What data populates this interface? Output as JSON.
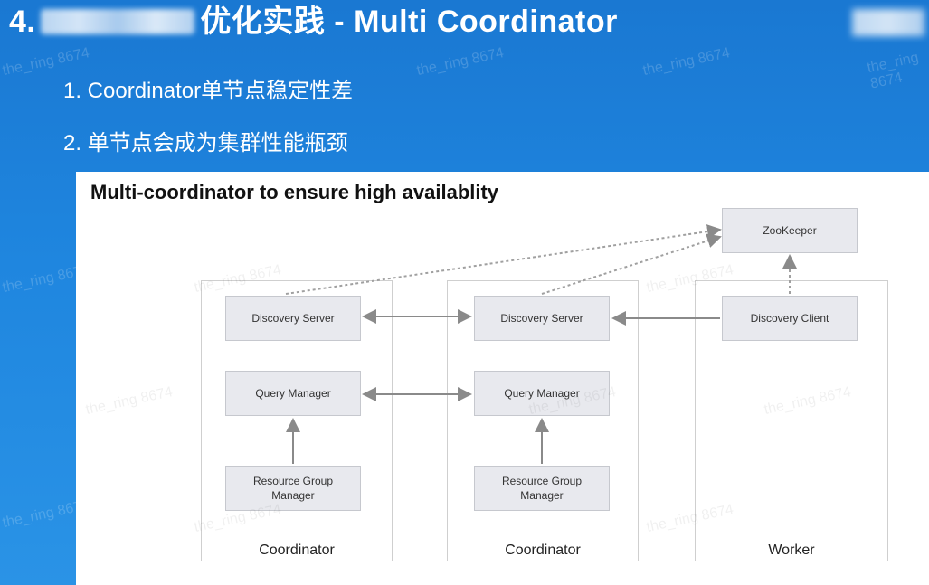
{
  "header": {
    "title_prefix": "4.",
    "title_suffix": "优化实践 - Multi Coordinator"
  },
  "bullets": [
    "1. Coordinator单节点稳定性差",
    "2. 单节点会成为集群性能瓶颈"
  ],
  "diagram": {
    "title": "Multi-coordinator to ensure high availablity",
    "columns": [
      "Coordinator",
      "Coordinator",
      "Worker"
    ],
    "nodes": {
      "discovery_server": "Discovery Server",
      "query_manager": "Query  Manager",
      "resource_group_manager": "Resource Group\nManager",
      "zookeeper": "ZooKeeper",
      "discovery_client": "Discovery Client"
    }
  },
  "watermark": "the_ring 8674"
}
